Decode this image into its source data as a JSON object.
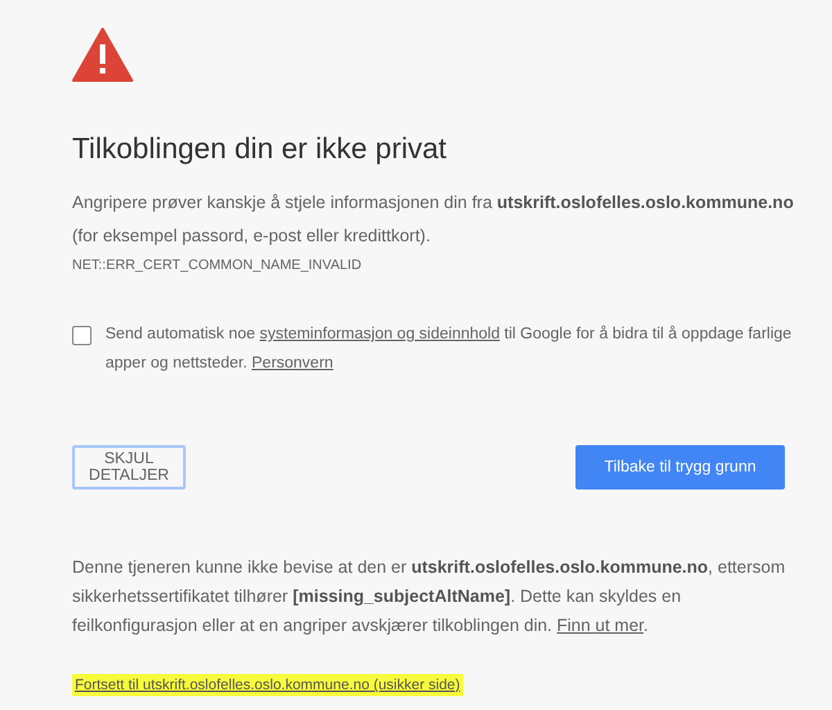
{
  "heading": "Tilkoblingen din er ikke privat",
  "intro": "Angripere prøver kanskje å stjele informasjonen din fra **utskrift.oslofelles.oslo.kommune.no** (for eksempel passord, e-post eller kredittkort).",
  "error_code": "NET::ERR_CERT_COMMON_NAME_INVALID",
  "report": {
    "checked": false,
    "parts": [
      {
        "kind": "text",
        "text": "Send automatisk noe "
      },
      {
        "kind": "link",
        "text": "systeminformasjon og sideinnhold"
      },
      {
        "kind": "text",
        "text": " til Google for å bidra til å oppdage farlige apper og nettsteder. "
      },
      {
        "kind": "link",
        "text": "Personvern"
      }
    ]
  },
  "buttons": [
    {
      "label": "SKJUL DETALJER",
      "kind": "secondary"
    },
    {
      "label": "Tilbake til trygg grunn",
      "kind": "primary"
    }
  ],
  "details": [
    {
      "kind": "text",
      "text": "Denne tjeneren kunne ikke bevise at den er **utskrift.oslofelles.oslo.kommune.no**, ettersom sikkerhetssertifikatet tilhører **[missing_subjectAltName]**. Dette kan skyldes en feilkonfigurasjon eller at en angriper avskjærer tilkoblingen din. "
    },
    {
      "kind": "link",
      "text": "Finn ut mer"
    },
    {
      "kind": "text",
      "text": "."
    }
  ],
  "proceed_link": {
    "text": "Fortsett til utskrift.oslofelles.oslo.kommune.no (usikker side)",
    "highlighted": true
  }
}
